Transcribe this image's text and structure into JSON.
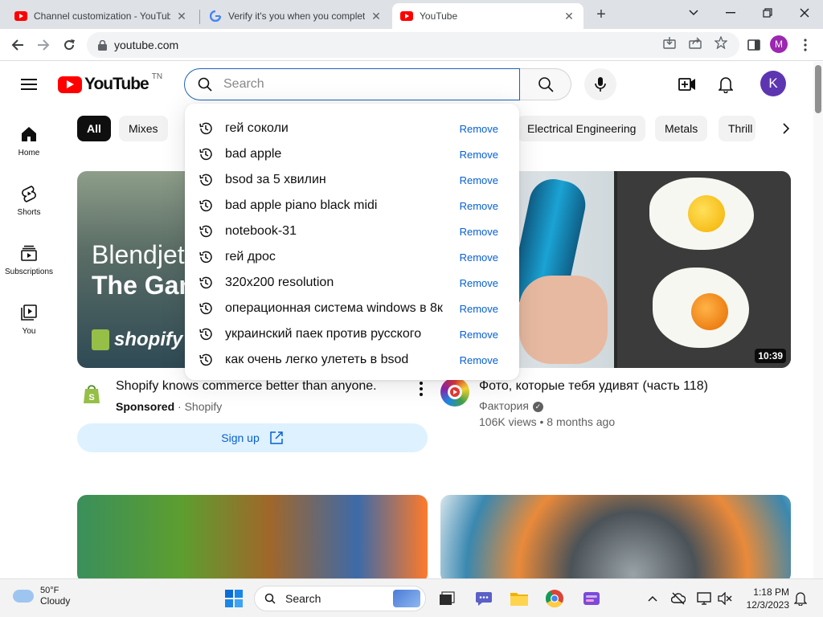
{
  "browser": {
    "tabs": [
      {
        "title": "Channel customization - YouTube"
      },
      {
        "title": "Verify it's you when you complete"
      },
      {
        "title": "YouTube"
      }
    ],
    "url": "youtube.com",
    "profile_initial": "M"
  },
  "youtube": {
    "logo_text": "YouTube",
    "logo_country": "TN",
    "search_placeholder": "Search",
    "avatar_initial": "K",
    "rail": [
      {
        "label": "Home"
      },
      {
        "label": "Shorts"
      },
      {
        "label": "Subscriptions"
      },
      {
        "label": "You"
      }
    ],
    "chips": [
      "All",
      "Mixes",
      "Electrical Engineering",
      "Metals",
      "Thrill"
    ],
    "suggestions": [
      {
        "query": "гей соколи",
        "action": "Remove"
      },
      {
        "query": "bad apple",
        "action": "Remove"
      },
      {
        "query": "bsod за 5 хвилин",
        "action": "Remove"
      },
      {
        "query": "bad apple piano black midi",
        "action": "Remove"
      },
      {
        "query": "notebook-31",
        "action": "Remove"
      },
      {
        "query": "гей дрос",
        "action": "Remove"
      },
      {
        "query": "320x200 resolution",
        "action": "Remove"
      },
      {
        "query": "операционная система windows в 8к",
        "action": "Remove"
      },
      {
        "query": "украинский паек против русского",
        "action": "Remove"
      },
      {
        "query": "как очень легко улететь в bsod",
        "action": "Remove"
      }
    ],
    "videos": [
      {
        "thumb_line1": "Blendjet",
        "thumb_line2": "The Gan",
        "thumb_brand": "shopify",
        "title": "Shopify knows commerce better than anyone.",
        "sponsored": "Sponsored",
        "channel": "Shopify",
        "cta": "Sign up"
      },
      {
        "title": "Фото, которые тебя удивят (часть 118)",
        "channel": "Фактория",
        "views": "106K views",
        "age": "8 months ago",
        "duration": "10:39"
      }
    ]
  },
  "taskbar": {
    "temp": "50°F",
    "condition": "Cloudy",
    "search_label": "Search",
    "time": "1:18 PM",
    "date": "12/3/2023"
  },
  "colors": {
    "yt_red": "#ff0000",
    "link_blue": "#065fd4",
    "search_focus": "#1c62b9",
    "avatar_k": "#5e35b1",
    "profile_m": "#9c27b0"
  }
}
